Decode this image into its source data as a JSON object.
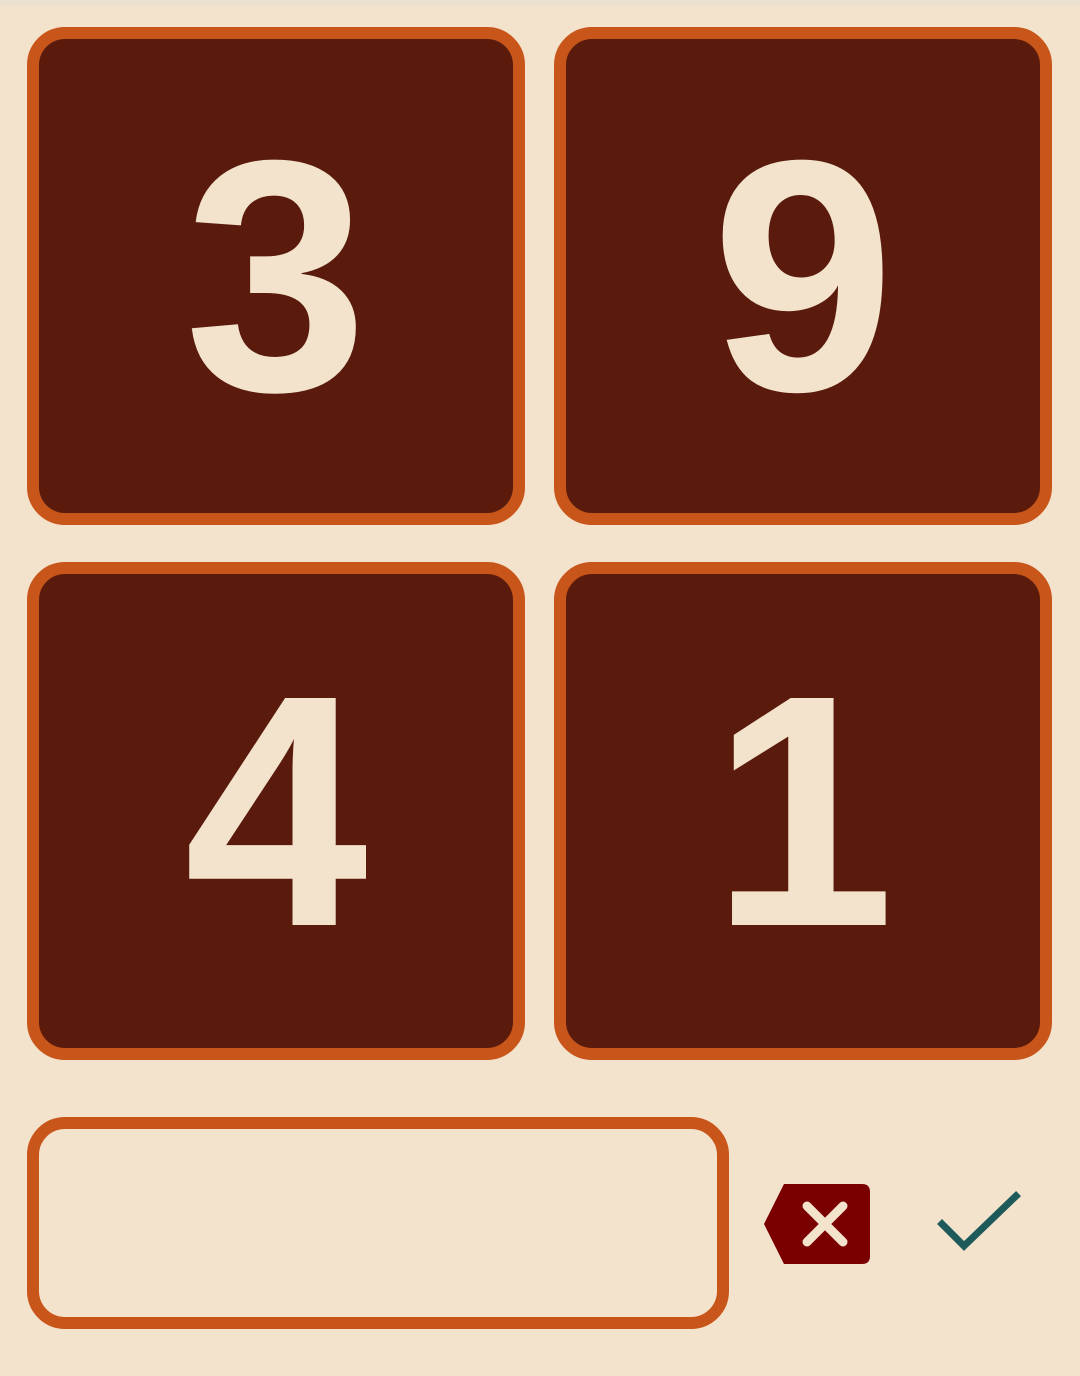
{
  "tiles": [
    {
      "value": "3"
    },
    {
      "value": "9"
    },
    {
      "value": "4"
    },
    {
      "value": "1"
    }
  ],
  "answer": {
    "value": ""
  },
  "icons": {
    "backspace": "backspace-icon",
    "confirm": "checkmark-icon"
  },
  "colors": {
    "background": "#f3e3cc",
    "tile_fill": "#5a1b0d",
    "tile_border": "#c85519",
    "digit": "#f3e3cc",
    "backspace": "#7a0000",
    "check": "#1f5a5a"
  }
}
